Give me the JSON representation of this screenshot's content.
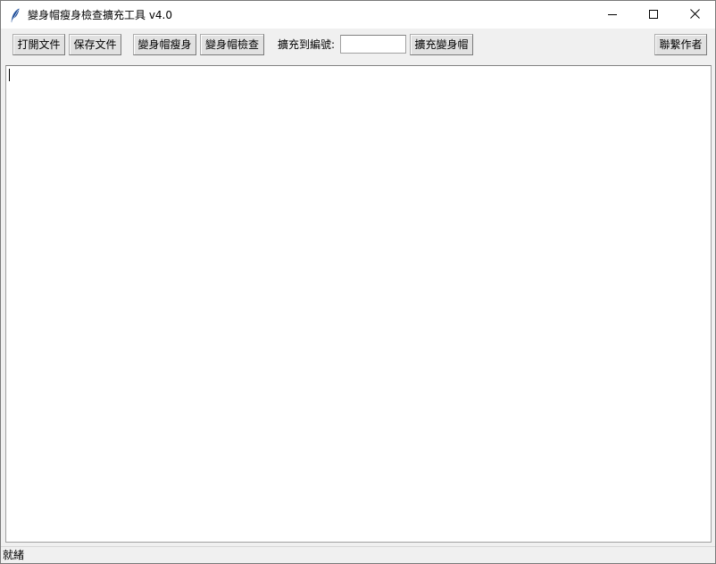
{
  "window": {
    "title": "變身帽瘦身檢查擴充工具 v4.0",
    "app_icon": "feather-icon",
    "controls": {
      "minimize_icon": "minimize-icon",
      "maximize_icon": "maximize-icon",
      "close_icon": "close-icon"
    }
  },
  "toolbar": {
    "open_label": "打開文件",
    "save_label": "保存文件",
    "slim_label": "變身帽瘦身",
    "check_label": "變身帽檢查",
    "expand_to_label": "擴充到編號:",
    "expand_to_value": "",
    "expand_button_label": "擴充變身帽",
    "contact_label": "聯繫作者"
  },
  "editor": {
    "content": ""
  },
  "status": {
    "text": "就緒"
  }
}
